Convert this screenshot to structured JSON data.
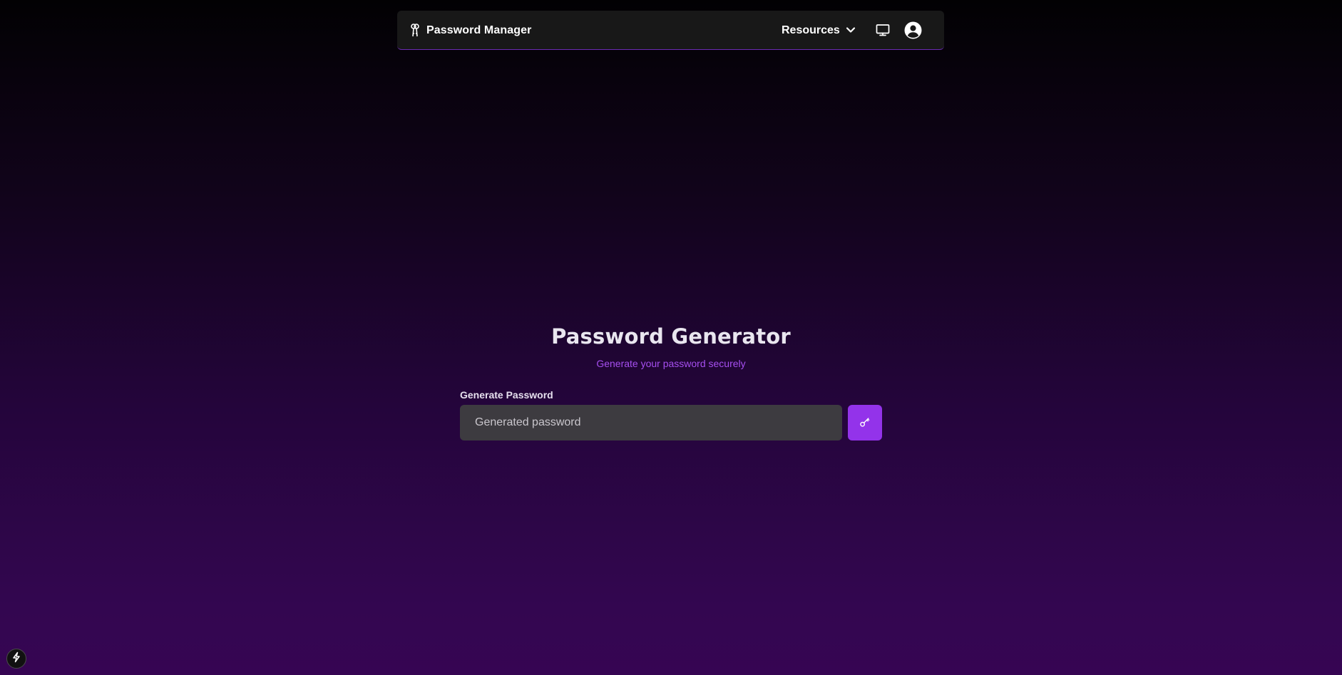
{
  "navbar": {
    "brand_label": "Password Manager",
    "brand_icon": "keys-icon",
    "resources_label": "Resources",
    "resources_icon": "chevron-down-icon",
    "monitor_icon": "monitor-icon",
    "user_icon": "user-circle-icon"
  },
  "hero": {
    "title": "Password Generator",
    "subtitle": "Generate your password securely"
  },
  "form": {
    "label": "Generate Password",
    "input_placeholder": "Generated password",
    "input_value": "",
    "generate_button_icon": "key-icon"
  },
  "badge": {
    "icon": "lightning-bolt-icon"
  },
  "colors": {
    "accent": "#9333ea",
    "subtitle": "#a64ff0",
    "navbar_bg": "#181818",
    "input_bg": "#3d3b40",
    "bg_top": "#020103",
    "bg_bottom": "#360553"
  }
}
